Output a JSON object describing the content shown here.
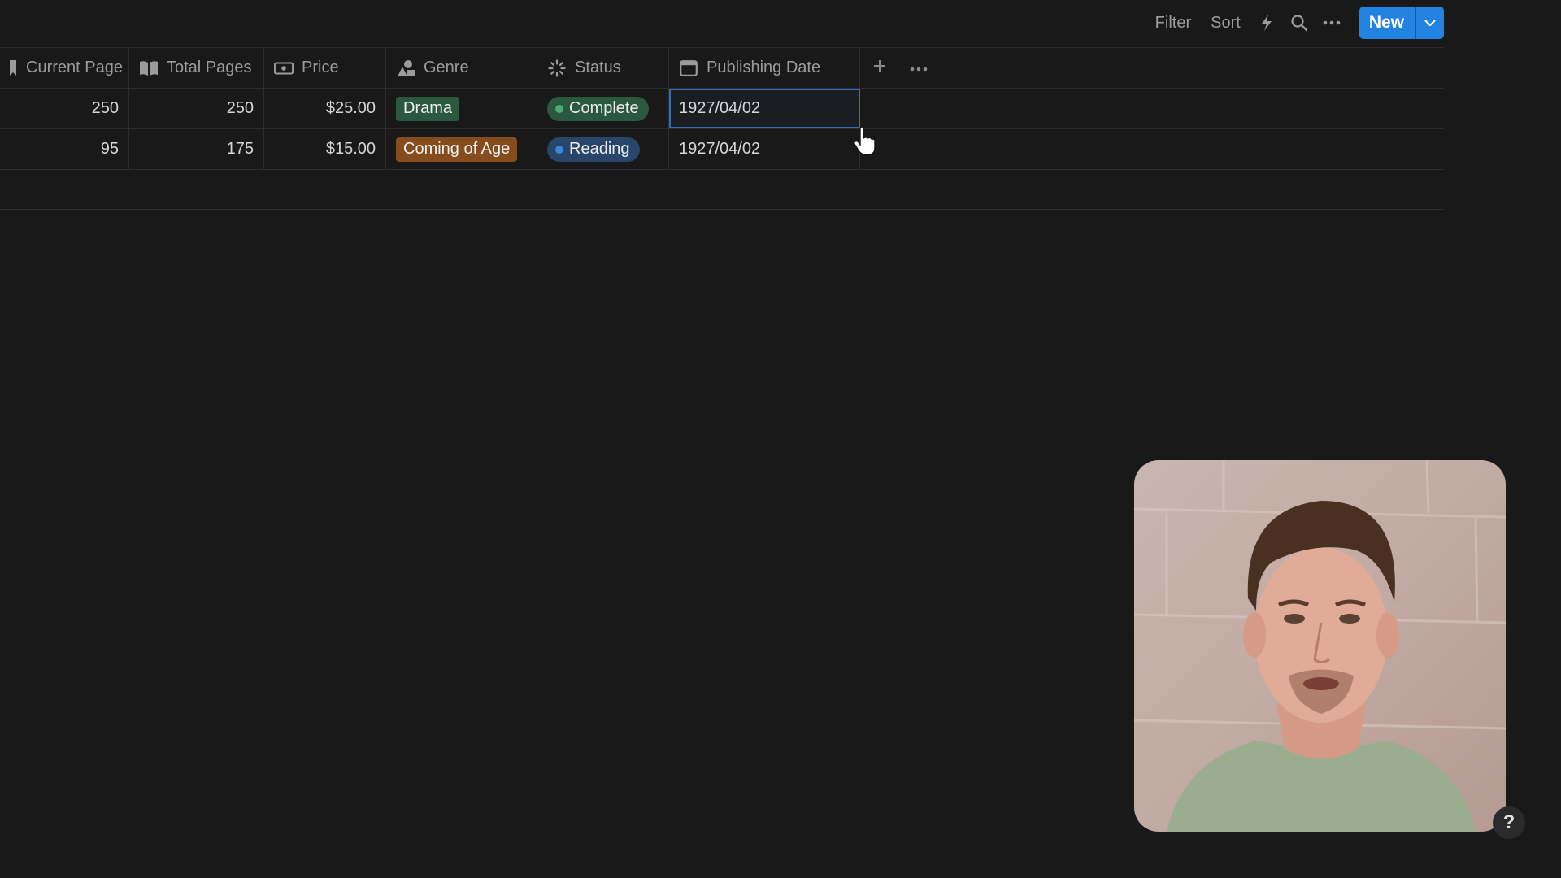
{
  "toolbar": {
    "filter_label": "Filter",
    "sort_label": "Sort",
    "automation_icon": "lightning-icon",
    "search_icon": "search-icon",
    "more_icon": "more-horizontal-icon",
    "new_label": "New",
    "new_dropdown_icon": "chevron-down-icon"
  },
  "table": {
    "columns": [
      {
        "label": "Current Page",
        "icon": "bookmark-icon"
      },
      {
        "label": "Total Pages",
        "icon": "book-icon"
      },
      {
        "label": "Price",
        "icon": "ticket-icon"
      },
      {
        "label": "Genre",
        "icon": "shapes-icon"
      },
      {
        "label": "Status",
        "icon": "status-spinner-icon"
      },
      {
        "label": "Publishing Date",
        "icon": "calendar-icon"
      }
    ],
    "add_property_icon": "plus-icon",
    "more_icon": "more-horizontal-icon",
    "rows": [
      {
        "current_page": "250",
        "total_pages": "250",
        "price": "$25.00",
        "genre": "Drama",
        "status": "Complete",
        "publishing_date": "1927/04/02"
      },
      {
        "current_page": "95",
        "total_pages": "175",
        "price": "$15.00",
        "genre": "Coming of Age",
        "status": "Reading",
        "publishing_date": "1927/04/02"
      }
    ]
  },
  "colors": {
    "background": "#191919",
    "accent_blue": "#2383e2",
    "genre_drama": "#2b593f",
    "genre_coming_of_age": "#854c1d",
    "status_complete_bg": "#2b593f",
    "status_complete_dot": "#4dab78",
    "status_reading_bg": "#28456c",
    "status_reading_dot": "#3a87d8"
  },
  "help": {
    "label": "?"
  }
}
